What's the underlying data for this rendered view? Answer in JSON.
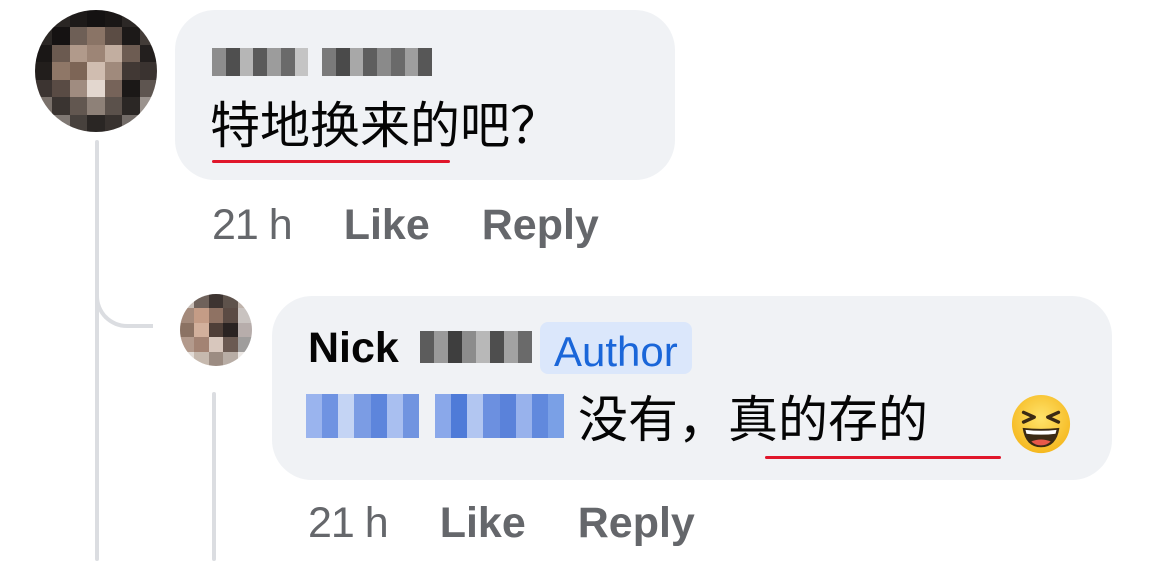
{
  "comments": [
    {
      "text": "特地换来的吧？",
      "timestamp": "21 h",
      "like_label": "Like",
      "reply_label": "Reply"
    },
    {
      "author_first": "Nick",
      "badge": "Author",
      "text": "没有，真的存的",
      "emoji": "grinning-squinting-face",
      "timestamp": "21 h",
      "like_label": "Like",
      "reply_label": "Reply"
    }
  ],
  "colors": {
    "bubble": "#f0f2f5",
    "badge_bg": "#dbe7fb",
    "badge_text": "#1a66d9",
    "meta_text": "#65676b",
    "spellcheck": "#e0162b"
  }
}
